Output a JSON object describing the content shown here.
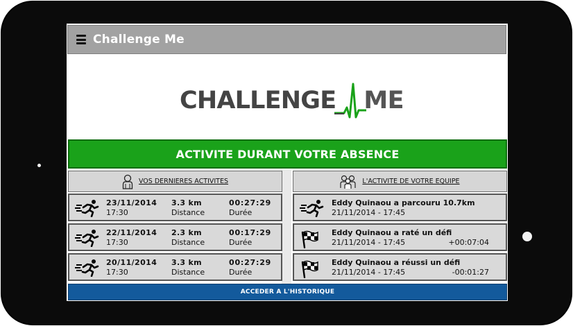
{
  "app": {
    "title": "Challenge Me"
  },
  "logo": {
    "part1": "CHALLENGE",
    "part2": "ME",
    "colors": {
      "text": "#444444",
      "pulse": "#1aa21a"
    }
  },
  "banner": {
    "label": "ACTIVITE DURANT VOTRE ABSENCE",
    "color": "#1aa21a"
  },
  "my_activities": {
    "header": "VOS DERNIERES ACTIVITES",
    "icon": "person-icon",
    "rows": [
      {
        "date": "23/11/2014",
        "time": "17:30",
        "distance": "3.3 km",
        "distance_label": "Distance",
        "duration": "00:27:29",
        "duration_label": "Durée",
        "icon": "runner-icon"
      },
      {
        "date": "22/11/2014",
        "time": "17:30",
        "distance": "2.3 km",
        "distance_label": "Distance",
        "duration": "00:17:29",
        "duration_label": "Durée",
        "icon": "runner-icon"
      },
      {
        "date": "20/11/2014",
        "time": "17:30",
        "distance": "3.3 km",
        "distance_label": "Distance",
        "duration": "00:27:29",
        "duration_label": "Durée",
        "icon": "runner-icon"
      }
    ]
  },
  "team_activity": {
    "header": "L'ACTIVITE DE VOTRE EQUIPE",
    "icon": "group-icon",
    "rows": [
      {
        "message": "Eddy Quinaou a parcouru 10.7km",
        "when": "21/11/2014 - 17:45",
        "delta": "",
        "icon": "runner-icon"
      },
      {
        "message": "Eddy Quinaou a raté un défi",
        "when": "21/11/2014 - 17:45",
        "delta": "+00:07:04",
        "icon": "checkered-flag-icon"
      },
      {
        "message": "Eddy Quinaou a réussi un défi",
        "when": "21/11/2014 - 17:45",
        "delta": "-00:01:27",
        "icon": "checkered-flag-icon"
      }
    ]
  },
  "footer": {
    "label": "ACCEDER A L'HISTORIQUE",
    "color": "#135a9c"
  }
}
